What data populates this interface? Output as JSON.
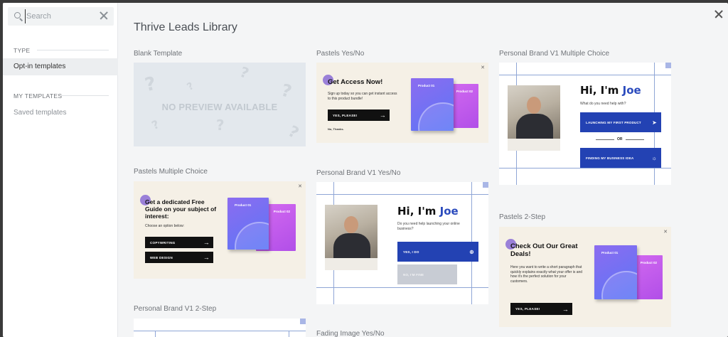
{
  "sidebar": {
    "search_placeholder": "Search",
    "type_label": "TYPE",
    "optin_label": "Opt-in templates",
    "my_templates_label": "MY TEMPLATES",
    "saved_label": "Saved templates"
  },
  "main": {
    "title": "Thrive Leads Library",
    "templates": {
      "blank": {
        "label": "Blank Template",
        "preview": "NO PREVIEW AVAILABLE"
      },
      "pastels_yesno": {
        "label": "Pastels Yes/No",
        "heading": "Get Access Now!",
        "body": "Sign up today so you can get instant access to this product bundle!",
        "button": "YES, PLEASE!",
        "decline": "No, Thanks.",
        "product1": "Product 01",
        "product2": "Product 02"
      },
      "pb_multiple": {
        "label": "Personal Brand V1 Multiple Choice",
        "hi": "Hi, I'm ",
        "name": "Joe",
        "question": "What do you need help with?",
        "option1": "LAUNCHING MY FIRST PRODUCT",
        "or": "OR",
        "option2": "FINDING MY BUSINESS IDEA"
      },
      "pastels_multiple": {
        "label": "Pastels Multiple Choice",
        "heading": "Get a dedicated Free Guide on your subject of interest:",
        "sub": "Choose an option below:",
        "option1": "COPYWRITING",
        "option2": "WEB DESIGN",
        "product1": "Product 01",
        "product2": "Product 02"
      },
      "pb_yesno": {
        "label": "Personal Brand V1 Yes/No",
        "hi": "Hi, I'm ",
        "name": "Joe",
        "question": "Do you need help launching your online business?",
        "yes": "YES, I DO",
        "no": "NO, I'M FINE"
      },
      "pastels_2step": {
        "label": "Pastels 2-Step",
        "heading": "Check Out Our Great Deals!",
        "body": "Here you want to write a short paragraph that quickly explains exactly what your offer is and how it's the perfect solution for your customers.",
        "button": "YES, PLEASE!",
        "product1": "Product 01",
        "product2": "Product 02"
      },
      "pb_2step": {
        "label": "Personal Brand V1 2-Step"
      },
      "fading": {
        "label": "Fading Image Yes/No"
      }
    }
  }
}
